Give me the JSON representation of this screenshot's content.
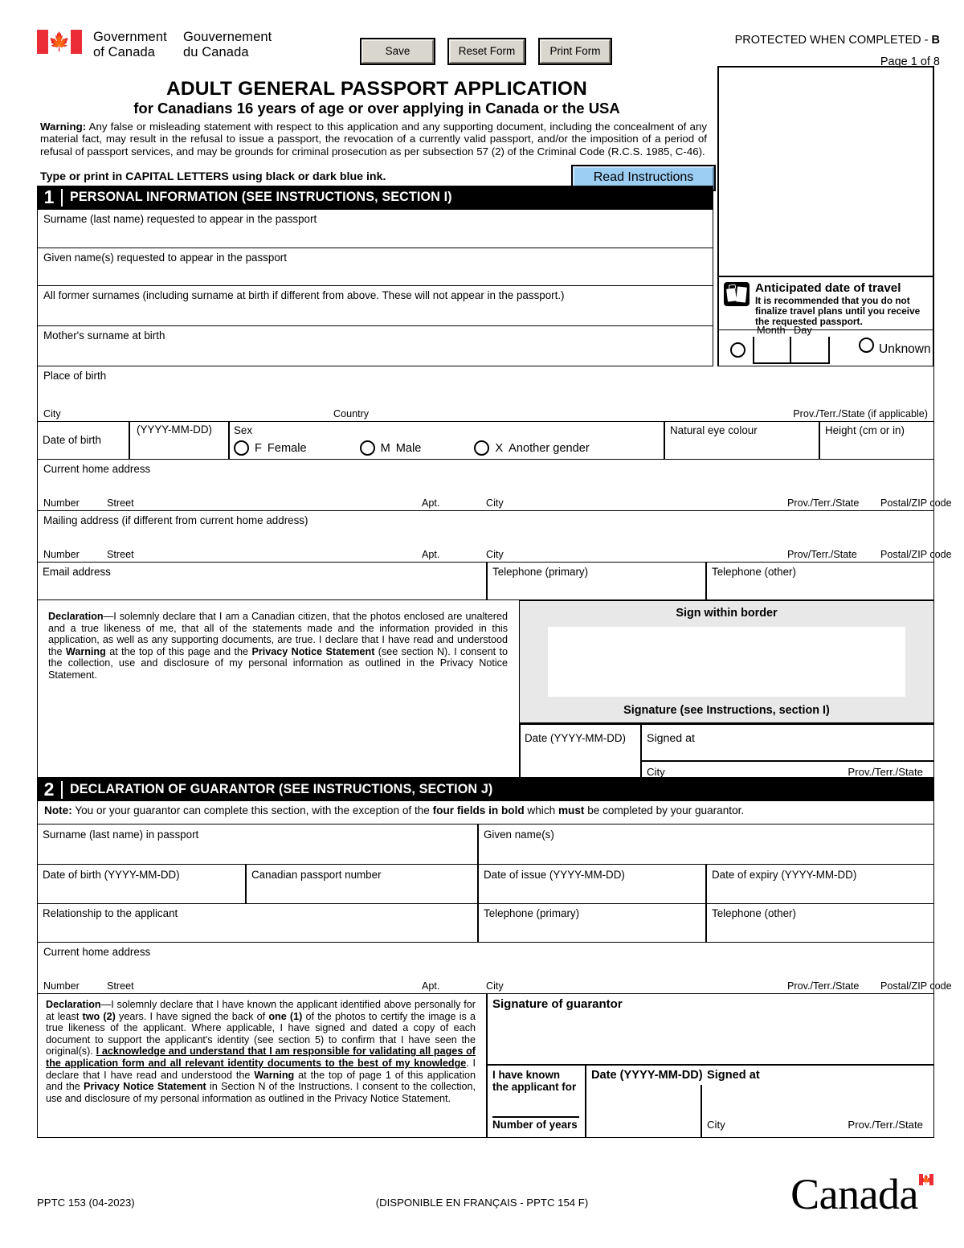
{
  "header": {
    "gov_en_line1": "Government",
    "gov_en_line2": "of Canada",
    "gov_fr_line1": "Gouvernement",
    "gov_fr_line2": "du Canada",
    "flag_icon": "canada-flag-icon",
    "protected_prefix": "PROTECTED WHEN COMPLETED - ",
    "protected_class": "B",
    "page_indicator": "Page 1 of 8",
    "buttons": {
      "save": "Save",
      "reset": "Reset Form",
      "print": "Print Form"
    }
  },
  "title": {
    "main": "ADULT GENERAL PASSPORT APPLICATION",
    "sub": "for Canadians 16 years of age or over applying in Canada or the USA",
    "warning_label": "Warning:",
    "warning_body": " Any false or misleading statement with respect to this application and any supporting document, including the concealment of any material fact, may result in the refusal to issue a passport, the revocation of a currently valid passport, and/or the imposition of a period of refusal of passport services, and may be grounds for criminal prosecution as per subsection 57 (2) of the Criminal Code (R.C.S. 1985, C-46).",
    "type_instruction": "Type or print in CAPITAL LETTERS using black or dark blue ink.",
    "read_instructions_button": "Read Instructions"
  },
  "travel": {
    "icon": "luggage-icon",
    "heading": "Anticipated date of travel",
    "note": "It is recommended that you do not finalize travel plans until you receive the requested passport.",
    "month_label": "Month",
    "day_label": "Day",
    "unknown_label": "Unknown"
  },
  "section1": {
    "number": "1",
    "title": "PERSONAL INFORMATION (SEE INSTRUCTIONS, SECTION I)",
    "surname": "Surname (last name) requested to appear in the passport",
    "given_names": "Given name(s) requested to appear in the passport",
    "former_surnames": "All former surnames (including surname at birth if different from above. These will not appear in the passport.)",
    "mother_surname": "Mother's surname at birth",
    "place_of_birth": "Place of birth",
    "pob_city": "City",
    "pob_country": "Country",
    "pob_prov": "Prov./Terr./State (if applicable)",
    "dob_label": "Date of birth",
    "dob_format": "(YYYY-MM-DD)",
    "sex_label": "Sex",
    "sex_options": [
      {
        "code": "F",
        "label": "Female"
      },
      {
        "code": "M",
        "label": "Male"
      },
      {
        "code": "X",
        "label": "Another gender"
      }
    ],
    "eye_colour": "Natural eye colour",
    "height": "Height (cm or in)",
    "current_address": "Current home address",
    "mailing_address": "Mailing address (if different from current home address)",
    "addr_number": "Number",
    "addr_street": "Street",
    "addr_apt": "Apt.",
    "addr_city": "City",
    "addr_prov": "Prov./Terr./State",
    "addr_prov_alt": "Prov/Terr./State",
    "addr_postal": "Postal/ZIP code",
    "email": "Email address",
    "tel_primary": "Telephone (primary)",
    "tel_other": "Telephone (other)",
    "declaration_label": "Declaration",
    "declaration_text": "—I solemnly declare that I am a Canadian citizen, that the photos enclosed are unaltered and a true likeness of me, that all of the statements made and the information provided in this application, as well as any supporting documents, are true. I declare that I have read and understood the ",
    "declaration_bold1": "Warning",
    "declaration_text2": " at the top of this page and the ",
    "declaration_bold2": "Privacy Notice Statement",
    "declaration_text3": " (see section N). I consent to the collection, use and disclosure of my personal information as outlined in the Privacy Notice Statement.",
    "sign_within_border": "Sign within border",
    "signature_caption": "Signature (see Instructions, section I)",
    "sign_date": "Date (YYYY-MM-DD)",
    "signed_at": "Signed at",
    "signed_city": "City",
    "signed_prov": "Prov./Terr./State"
  },
  "section2": {
    "number": "2",
    "title": "DECLARATION OF GUARANTOR (SEE INSTRUCTIONS, SECTION J)",
    "note_label": "Note:",
    "note_text1": " You or your guarantor can complete this section, with the exception of the ",
    "note_bold1": "four fields in bold",
    "note_text2": " which ",
    "note_bold2": "must",
    "note_text3": " be completed by your guarantor.",
    "surname": "Surname (last name) in passport",
    "given_names": "Given name(s)",
    "dob": "Date of birth (YYYY-MM-DD)",
    "passport_number": "Canadian passport number",
    "date_of_issue": "Date of issue (YYYY-MM-DD)",
    "date_of_expiry": "Date of expiry (YYYY-MM-DD)",
    "relationship": "Relationship to the applicant",
    "tel_primary": "Telephone (primary)",
    "tel_other": "Telephone (other)",
    "current_address": "Current home address",
    "addr_number": "Number",
    "addr_street": "Street",
    "addr_apt": "Apt.",
    "addr_city": "City",
    "addr_prov": "Prov./Terr./State",
    "addr_postal": "Postal/ZIP code",
    "declaration_label": "Declaration",
    "declaration_p1": "—I solemnly declare that I have known the applicant identified above personally for at least ",
    "declaration_b1": "two (2)",
    "declaration_p2": " years. I have signed the back of ",
    "declaration_b2": "one (1)",
    "declaration_p3": " of the photos to certify the image is a true likeness of the applicant. Where applicable, I have signed and dated a copy of each document to support the applicant's identity (see section 5) to confirm that I have seen the original(s). ",
    "declaration_u1": "I acknowledge and understand that I am responsible for validating all pages of the application form and all relevant identity documents to the best of my knowledge",
    "declaration_p4": ". I declare that I have read and understood the ",
    "declaration_b3": "Warning",
    "declaration_p5": " at the top of page 1 of this application and the ",
    "declaration_b4": "Privacy Notice Statement",
    "declaration_p6": " in Section N of the Instructions. I consent to the collection, use and disclosure of my personal information as outlined in the Privacy Notice Statement.",
    "signature_of_guarantor": "Signature of guarantor",
    "known_for_line1": "I have known",
    "known_for_line2": "the applicant for",
    "number_of_years": "Number of years",
    "date_label": "Date (YYYY-MM-DD)",
    "signed_at": "Signed at",
    "signed_city": "City",
    "signed_prov": "Prov./Terr./State"
  },
  "footer": {
    "form_code": "PPTC 153 (04-2023)",
    "french_note": "(DISPONIBLE EN FRANÇAIS - PPTC 154 F)",
    "wordmark": "Canada",
    "wordmark_flag": "canada-flag-icon"
  }
}
